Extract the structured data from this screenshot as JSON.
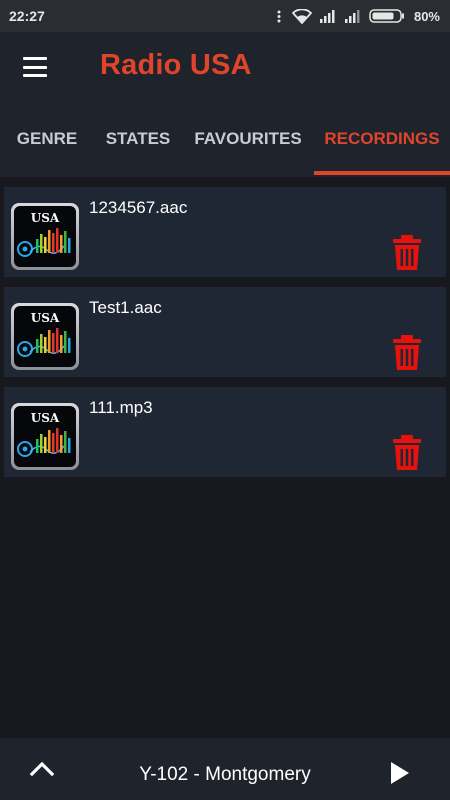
{
  "status_bar": {
    "time": "22:27",
    "battery_percent": "80%",
    "icons": [
      "wifi-icon",
      "signal-icon",
      "signal-icon",
      "battery-icon"
    ]
  },
  "app_bar": {
    "title": "Radio USA",
    "menu_icon": "hamburger-menu-icon"
  },
  "tabs": [
    {
      "label": "GENRE",
      "active": false
    },
    {
      "label": "STATES",
      "active": false
    },
    {
      "label": "FAVOURITES",
      "active": false
    },
    {
      "label": "RECORDINGS",
      "active": true
    }
  ],
  "recordings": [
    {
      "thumb_label": "USA",
      "name": "1234567.aac",
      "delete_icon": "trash-icon"
    },
    {
      "thumb_label": "USA",
      "name": "Test1.aac",
      "delete_icon": "trash-icon"
    },
    {
      "thumb_label": "USA",
      "name": "111.mp3",
      "delete_icon": "trash-icon"
    }
  ],
  "player": {
    "station": "Y-102 - Montgomery",
    "expand_icon": "chevron-up-icon",
    "play_icon": "play-icon"
  },
  "colors": {
    "accent": "#e0452b",
    "delete": "#e8120c",
    "background": "#17191f",
    "bar": "#1f232c",
    "item": "#202734"
  }
}
